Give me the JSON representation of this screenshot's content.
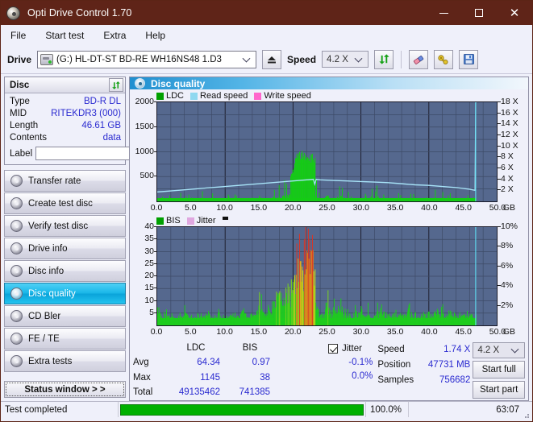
{
  "window": {
    "title": "Opti Drive Control 1.70",
    "icon": "disc-icon",
    "minimize_label": "–",
    "maximize_label": "☐",
    "close_label": "✕"
  },
  "menu": {
    "items": [
      {
        "label": "File"
      },
      {
        "label": "Start test"
      },
      {
        "label": "Extra"
      },
      {
        "label": "Help"
      }
    ]
  },
  "drivebar": {
    "drive_label": "Drive",
    "drive_value": "(G:)   HL-DT-ST BD-RE  WH16NS48 1.D3",
    "eject_icon": "eject-icon",
    "speed_label": "Speed",
    "speed_value": "4.2 X",
    "refresh_icon": "refresh-icon",
    "erase_icon": "eraser-icon",
    "key_icon": "key-icon",
    "save_icon": "save-icon"
  },
  "disc_panel": {
    "title": "Disc",
    "refresh_icon": "refresh-icon",
    "rows": [
      {
        "key": "Type",
        "value": "BD-R DL"
      },
      {
        "key": "MID",
        "value": "RITEKDR3 (000)"
      },
      {
        "key": "Length",
        "value": "46.61 GB"
      },
      {
        "key": "Contents",
        "value": "data"
      }
    ],
    "label_key": "Label",
    "label_value": "",
    "label_placeholder": "",
    "disc_icon": "cd-icon"
  },
  "sidebar": {
    "items": [
      {
        "label": "Transfer rate",
        "active": false
      },
      {
        "label": "Create test disc",
        "active": false
      },
      {
        "label": "Verify test disc",
        "active": false
      },
      {
        "label": "Drive info",
        "active": false
      },
      {
        "label": "Disc info",
        "active": false
      },
      {
        "label": "Disc quality",
        "active": true
      },
      {
        "label": "CD Bler",
        "active": false
      },
      {
        "label": "FE / TE",
        "active": false
      },
      {
        "label": "Extra tests",
        "active": false
      }
    ],
    "status_window_label": "Status window > >"
  },
  "panel": {
    "header_title": "Disc quality",
    "header_icon": "disc-quality-icon"
  },
  "stats": {
    "col_headers": [
      "",
      "LDC",
      "BIS"
    ],
    "rows": [
      {
        "key": "Avg",
        "ldc": "64.34",
        "bis": "0.97"
      },
      {
        "key": "Max",
        "ldc": "1145",
        "bis": "38"
      },
      {
        "key": "Total",
        "ldc": "49135462",
        "bis": "741385"
      }
    ],
    "jitter_label": "Jitter",
    "jitter_checked": true,
    "jitter_avg": "-0.1%",
    "jitter_max": "0.0%",
    "speed_key": "Speed",
    "speed_value": "1.74 X",
    "position_key": "Position",
    "position_value": "47731 MB",
    "samples_key": "Samples",
    "samples_value": "756682",
    "speed_select": "4.2 X",
    "start_full_label": "Start full",
    "start_part_label": "Start part"
  },
  "statusbar": {
    "text": "Test completed",
    "percent": "100.0%",
    "progress": 100,
    "time": "63:07",
    "progress_color": "#00b000"
  },
  "chart_data": [
    {
      "id": "ldc-chart",
      "type": "area",
      "title": "",
      "xlabel": "GB",
      "ylabel": "",
      "xlim": [
        0,
        50
      ],
      "ylim": [
        0,
        2000
      ],
      "y2lim": [
        0,
        18
      ],
      "grid": true,
      "legend_position": "top-left",
      "legend": [
        {
          "name": "LDC",
          "color": "#00a000"
        },
        {
          "name": "Read speed",
          "color": "#8fd8f0"
        },
        {
          "name": "Write speed",
          "color": "#ff66cc"
        }
      ],
      "xticks": [
        "0.0",
        "5.0",
        "10.0",
        "15.0",
        "20.0",
        "25.0",
        "30.0",
        "35.0",
        "40.0",
        "45.0",
        "50.0"
      ],
      "yticks": [
        500,
        1000,
        1500,
        2000
      ],
      "y2ticks": [
        "2 X",
        "4 X",
        "6 X",
        "8 X",
        "10 X",
        "12 X",
        "14 X",
        "16 X",
        "18 X"
      ],
      "series": [
        {
          "name": "LDC",
          "color": "#00c000",
          "x": [
            0.0,
            0.5,
            1.0,
            1.5,
            2.0,
            2.5,
            3.0,
            3.5,
            4.0,
            4.5,
            5.0,
            5.5,
            6.0,
            6.5,
            7.0,
            7.5,
            8.0,
            8.5,
            9.0,
            9.5,
            10.0,
            10.5,
            11.0,
            11.5,
            12.0,
            12.5,
            13.0,
            13.5,
            14.0,
            14.5,
            15.0,
            15.5,
            16.0,
            16.5,
            17.0,
            17.5,
            18.0,
            18.5,
            19.0,
            19.5,
            20.0,
            20.5,
            21.0,
            21.5,
            22.0,
            22.5,
            23.0,
            23.2,
            23.4,
            23.6,
            24.0,
            24.5,
            25.0,
            25.5,
            26.0,
            26.5,
            27.0,
            27.5,
            28.0,
            28.5,
            29.0,
            29.5,
            30.0,
            30.5,
            31.0,
            31.5,
            32.0,
            32.5,
            33.0,
            33.5,
            34.0,
            34.5,
            35.0,
            35.5,
            36.0,
            36.5,
            37.0,
            37.5,
            38.0,
            38.5,
            39.0,
            39.5,
            40.0,
            40.5,
            41.0,
            41.5,
            42.0,
            42.5,
            43.0,
            43.5,
            44.0,
            44.5,
            45.0,
            45.5,
            46.0,
            46.5,
            47.0
          ],
          "values": [
            330,
            120,
            95,
            150,
            90,
            110,
            80,
            230,
            95,
            100,
            270,
            90,
            110,
            310,
            85,
            95,
            120,
            260,
            90,
            105,
            300,
            95,
            280,
            110,
            90,
            260,
            120,
            100,
            330,
            115,
            420,
            150,
            200,
            280,
            330,
            250,
            390,
            420,
            460,
            520,
            700,
            980,
            1050,
            1000,
            1010,
            960,
            940,
            900,
            450,
            120,
            230,
            140,
            520,
            180,
            260,
            150,
            480,
            130,
            200,
            110,
            160,
            250,
            120,
            190,
            140,
            420,
            160,
            380,
            150,
            170,
            110,
            230,
            130,
            150,
            210,
            120,
            160,
            140,
            190,
            120,
            170,
            310,
            130,
            150,
            260,
            120,
            180,
            140,
            160,
            110,
            240,
            130,
            150,
            110,
            170,
            120
          ]
        },
        {
          "name": "Read speed",
          "color": "#a8e4f8",
          "x": [
            0.0,
            2.0,
            4.0,
            6.0,
            8.0,
            10.0,
            12.0,
            14.0,
            16.0,
            18.0,
            20.0,
            22.0,
            23.0,
            23.2,
            23.4,
            24.0,
            26.0,
            28.0,
            30.0,
            32.0,
            34.0,
            36.0,
            38.0,
            40.0,
            42.0,
            44.0,
            46.0,
            46.8,
            46.9,
            47.0
          ],
          "values_x_speed": [
            1.7,
            1.9,
            2.1,
            2.3,
            2.5,
            2.7,
            2.9,
            3.1,
            3.3,
            3.5,
            3.7,
            3.9,
            4.0,
            3.1,
            4.0,
            3.9,
            3.8,
            3.7,
            3.6,
            3.5,
            3.4,
            3.2,
            3.0,
            2.9,
            2.7,
            2.5,
            2.2,
            2.0,
            18.0,
            18.0
          ]
        }
      ]
    },
    {
      "id": "bis-chart",
      "type": "area",
      "title": "",
      "xlabel": "GB",
      "ylabel": "",
      "xlim": [
        0,
        50
      ],
      "ylim": [
        0,
        40
      ],
      "y2lim": [
        0,
        10
      ],
      "grid": true,
      "legend_position": "top-left",
      "legend": [
        {
          "name": "BIS",
          "color": "#00a000"
        },
        {
          "name": "Jitter",
          "color": "#e0a8e0"
        }
      ],
      "xticks": [
        "0.0",
        "5.0",
        "10.0",
        "15.0",
        "20.0",
        "25.0",
        "30.0",
        "35.0",
        "40.0",
        "45.0",
        "50.0"
      ],
      "yticks": [
        5,
        10,
        15,
        20,
        25,
        30,
        35,
        40
      ],
      "y2ticks": [
        "2%",
        "4%",
        "6%",
        "8%",
        "10%"
      ],
      "series": [
        {
          "name": "BIS",
          "color": "#00c000",
          "x": [
            0.0,
            0.5,
            1.0,
            1.5,
            2.0,
            2.5,
            3.0,
            3.5,
            4.0,
            4.5,
            5.0,
            5.5,
            6.0,
            6.5,
            7.0,
            7.5,
            8.0,
            8.5,
            9.0,
            9.5,
            10.0,
            10.5,
            11.0,
            11.5,
            12.0,
            12.5,
            13.0,
            13.5,
            14.0,
            14.5,
            15.0,
            15.5,
            16.0,
            16.5,
            17.0,
            17.5,
            18.0,
            18.5,
            19.0,
            19.5,
            20.0,
            20.5,
            21.0,
            21.5,
            22.0,
            22.5,
            23.0,
            23.2,
            23.5,
            24.0,
            24.5,
            25.0,
            25.5,
            26.0,
            26.5,
            27.0,
            27.5,
            28.0,
            28.5,
            29.0,
            29.5,
            30.0,
            30.5,
            31.0,
            31.5,
            32.0,
            32.5,
            33.0,
            33.5,
            34.0,
            34.5,
            35.0,
            35.5,
            36.0,
            36.5,
            37.0,
            37.5,
            38.0,
            38.5,
            39.0,
            39.5,
            40.0,
            40.5,
            41.0,
            41.5,
            42.0,
            42.5,
            43.0,
            43.5,
            44.0,
            44.5,
            45.0,
            45.5,
            46.0,
            46.5,
            47.0
          ],
          "values": [
            10,
            4,
            5,
            4,
            6,
            4,
            5,
            4,
            7,
            4,
            5,
            4,
            6,
            5,
            4,
            6,
            4,
            5,
            7,
            4,
            5,
            4,
            6,
            5,
            4,
            7,
            5,
            4,
            6,
            5,
            9,
            6,
            7,
            10,
            8,
            12,
            14,
            9,
            16,
            13,
            22,
            28,
            32,
            30,
            38,
            29,
            33,
            25,
            8,
            5,
            6,
            12,
            5,
            9,
            6,
            11,
            5,
            7,
            4,
            6,
            5,
            8,
            5,
            6,
            4,
            7,
            5,
            9,
            5,
            6,
            4,
            7,
            5,
            6,
            4,
            8,
            5,
            6,
            4,
            7,
            5,
            6,
            4,
            8,
            5,
            6,
            4,
            7,
            5,
            6,
            4,
            5,
            4,
            6,
            4,
            5
          ]
        }
      ]
    }
  ]
}
